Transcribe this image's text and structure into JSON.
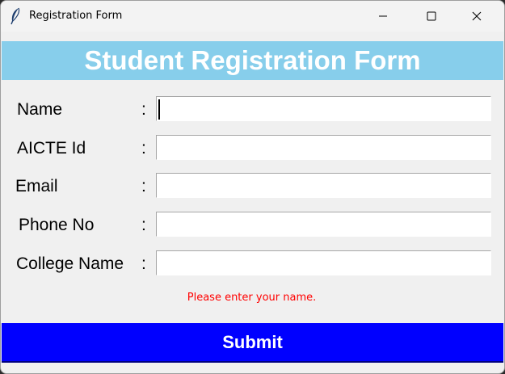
{
  "window": {
    "title": "Registration Form",
    "icon": "feather-icon"
  },
  "header": {
    "title": "Student Registration Form",
    "background": "#87ceeb"
  },
  "form": {
    "fields": [
      {
        "label": "Name",
        "colon": ":",
        "value": ""
      },
      {
        "label": "AICTE Id",
        "colon": ":",
        "value": ""
      },
      {
        "label": "Email",
        "colon": ":",
        "value": ""
      },
      {
        "label": "Phone No",
        "colon": ":",
        "value": ""
      },
      {
        "label": "College Name",
        "colon": ":",
        "value": ""
      }
    ],
    "error_message": "Please enter your name.",
    "error_color": "#ff0000"
  },
  "submit": {
    "label": "Submit",
    "background": "#0000ff"
  }
}
